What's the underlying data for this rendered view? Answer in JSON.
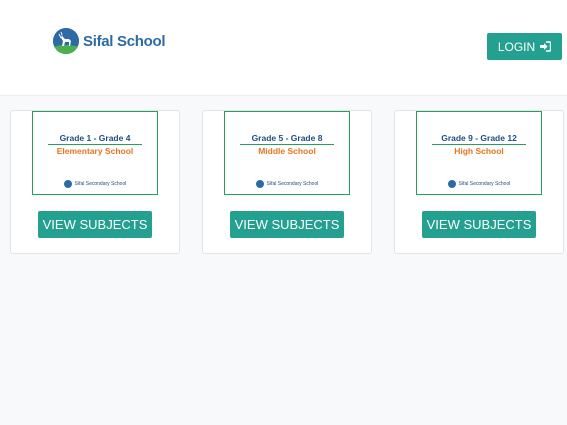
{
  "header": {
    "brand_name": "Sifal School",
    "login_label": "LOGIN"
  },
  "colors": {
    "accent": "#23a08f",
    "brand": "#2d6aa6",
    "level_text": "#e8741e",
    "thumb_border": "#23a060"
  },
  "cards": [
    {
      "grade_range": "Grade 1 - Grade 4",
      "level": "Elementary School",
      "footer": "Sifal Secondary School",
      "button_label": "VIEW SUBJECTS"
    },
    {
      "grade_range": "Grade 5 - Grade 8",
      "level": "Middle School",
      "footer": "Sifal Secondary School",
      "button_label": "VIEW SUBJECTS"
    },
    {
      "grade_range": "Grade 9 - Grade 12",
      "level": "High School",
      "footer": "Sifal Secondary School",
      "button_label": "VIEW SUBJECTS"
    }
  ]
}
